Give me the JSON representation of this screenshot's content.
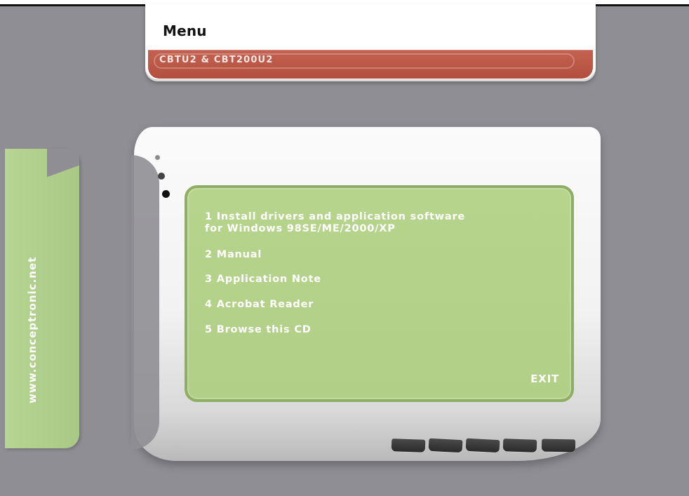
{
  "header": {
    "title": "Menu",
    "model": "CBTU2 & CBT200U2"
  },
  "sidebar": {
    "website": "www.conceptronic.net"
  },
  "menu": {
    "items": [
      "1 Install drivers and application software\n   for Windows 98SE/ME/2000/XP",
      "2 Manual",
      "3 Application Note",
      "4 Acrobat Reader",
      "5 Browse this CD"
    ],
    "exit_label": "EXIT"
  },
  "colors": {
    "background": "#8f8e94",
    "screen_green": "#b5d28a",
    "header_bar_red": "#b9503f",
    "text_white": "#ffffff"
  }
}
